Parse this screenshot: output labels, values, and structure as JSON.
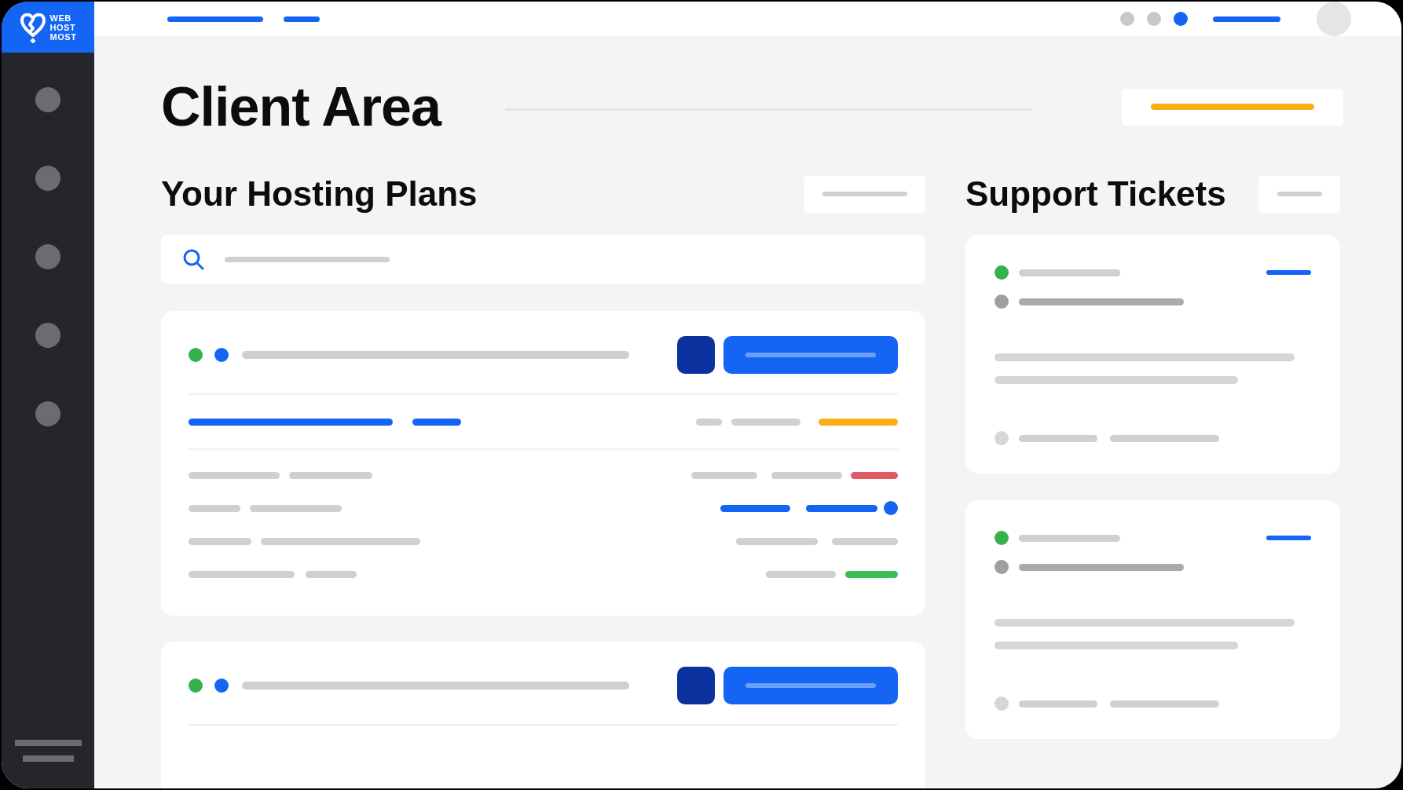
{
  "logo": {
    "words": [
      "WEB",
      "HOST",
      "MOST"
    ]
  },
  "page_title": "Client Area",
  "hosting_plans": {
    "heading": "Your Hosting Plans"
  },
  "support_tickets": {
    "heading": "Support Tickets"
  }
}
